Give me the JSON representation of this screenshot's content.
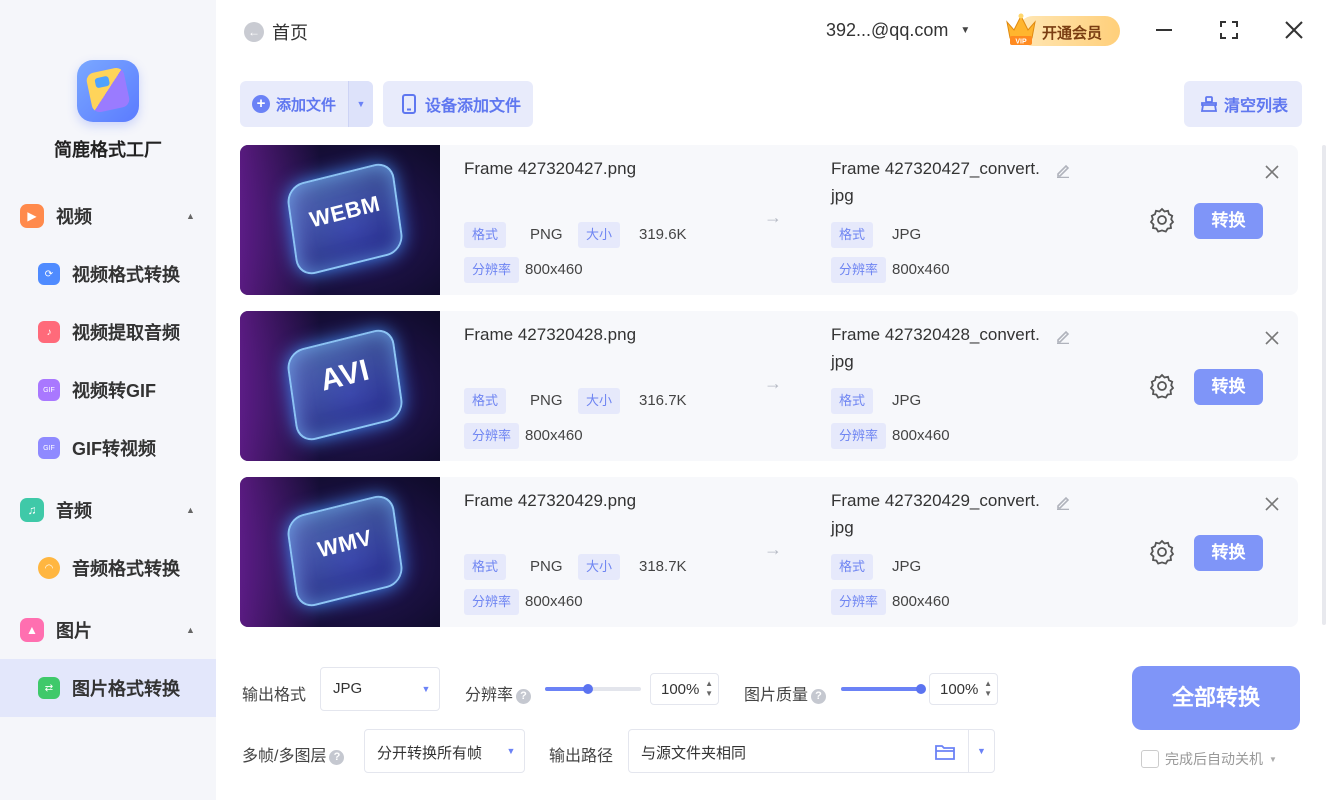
{
  "app": {
    "name": "简鹿格式工厂"
  },
  "header": {
    "home_label": "首页",
    "account": "392...@qq.com",
    "vip_label": "开通会员",
    "vip_badge": "VIP"
  },
  "sidebar": {
    "sections": [
      {
        "label": "视频",
        "items": [
          "视频格式转换",
          "视频提取音频",
          "视频转GIF",
          "GIF转视频"
        ]
      },
      {
        "label": "音频",
        "items": [
          "音频格式转换"
        ]
      },
      {
        "label": "图片",
        "items": [
          "图片格式转换"
        ]
      }
    ],
    "active_item": "图片格式转换",
    "icon_badge_gif": "GIF",
    "colors": {
      "video": "#ff8a4c",
      "audio": "#3fc9a8",
      "image": "#ff6fb0",
      "active_bg": "#e3e7fb"
    }
  },
  "toolbar": {
    "add_file": "添加文件",
    "device_add": "设备添加文件",
    "clear_list": "清空列表"
  },
  "files": [
    {
      "thumb_label": "WEBM",
      "source_name": "Frame 427320427.png",
      "src_format": "PNG",
      "src_size": "319.6K",
      "src_resolution": "800x460",
      "target_name_1": "Frame 427320427_convert.",
      "target_name_2": "jpg",
      "dst_format": "JPG",
      "dst_resolution": "800x460",
      "convert_label": "转换"
    },
    {
      "thumb_label": "AVI",
      "source_name": "Frame 427320428.png",
      "src_format": "PNG",
      "src_size": "316.7K",
      "src_resolution": "800x460",
      "target_name_1": "Frame 427320428_convert.",
      "target_name_2": "jpg",
      "dst_format": "JPG",
      "dst_resolution": "800x460",
      "convert_label": "转换"
    },
    {
      "thumb_label": "WMV",
      "source_name": "Frame 427320429.png",
      "src_format": "PNG",
      "src_size": "318.7K",
      "src_resolution": "800x460",
      "target_name_1": "Frame 427320429_convert.",
      "target_name_2": "jpg",
      "dst_format": "JPG",
      "dst_resolution": "800x460",
      "convert_label": "转换"
    }
  ],
  "tags": {
    "format": "格式",
    "size": "大小",
    "resolution": "分辨率"
  },
  "settings": {
    "output_format_label": "输出格式",
    "output_format": "JPG",
    "resolution_label": "分辨率",
    "resolution_value": "100%",
    "resolution_level": 0.45,
    "quality_label": "图片质量",
    "quality_value": "100%",
    "quality_level": 1.0,
    "multiframe_label": "多帧/多图层",
    "multiframe_value": "分开转换所有帧",
    "output_path_label": "输出路径",
    "output_path": "与源文件夹相同",
    "convert_all": "全部转换",
    "auto_shutdown": "完成后自动关机"
  },
  "accent_color": "#7f95f8"
}
